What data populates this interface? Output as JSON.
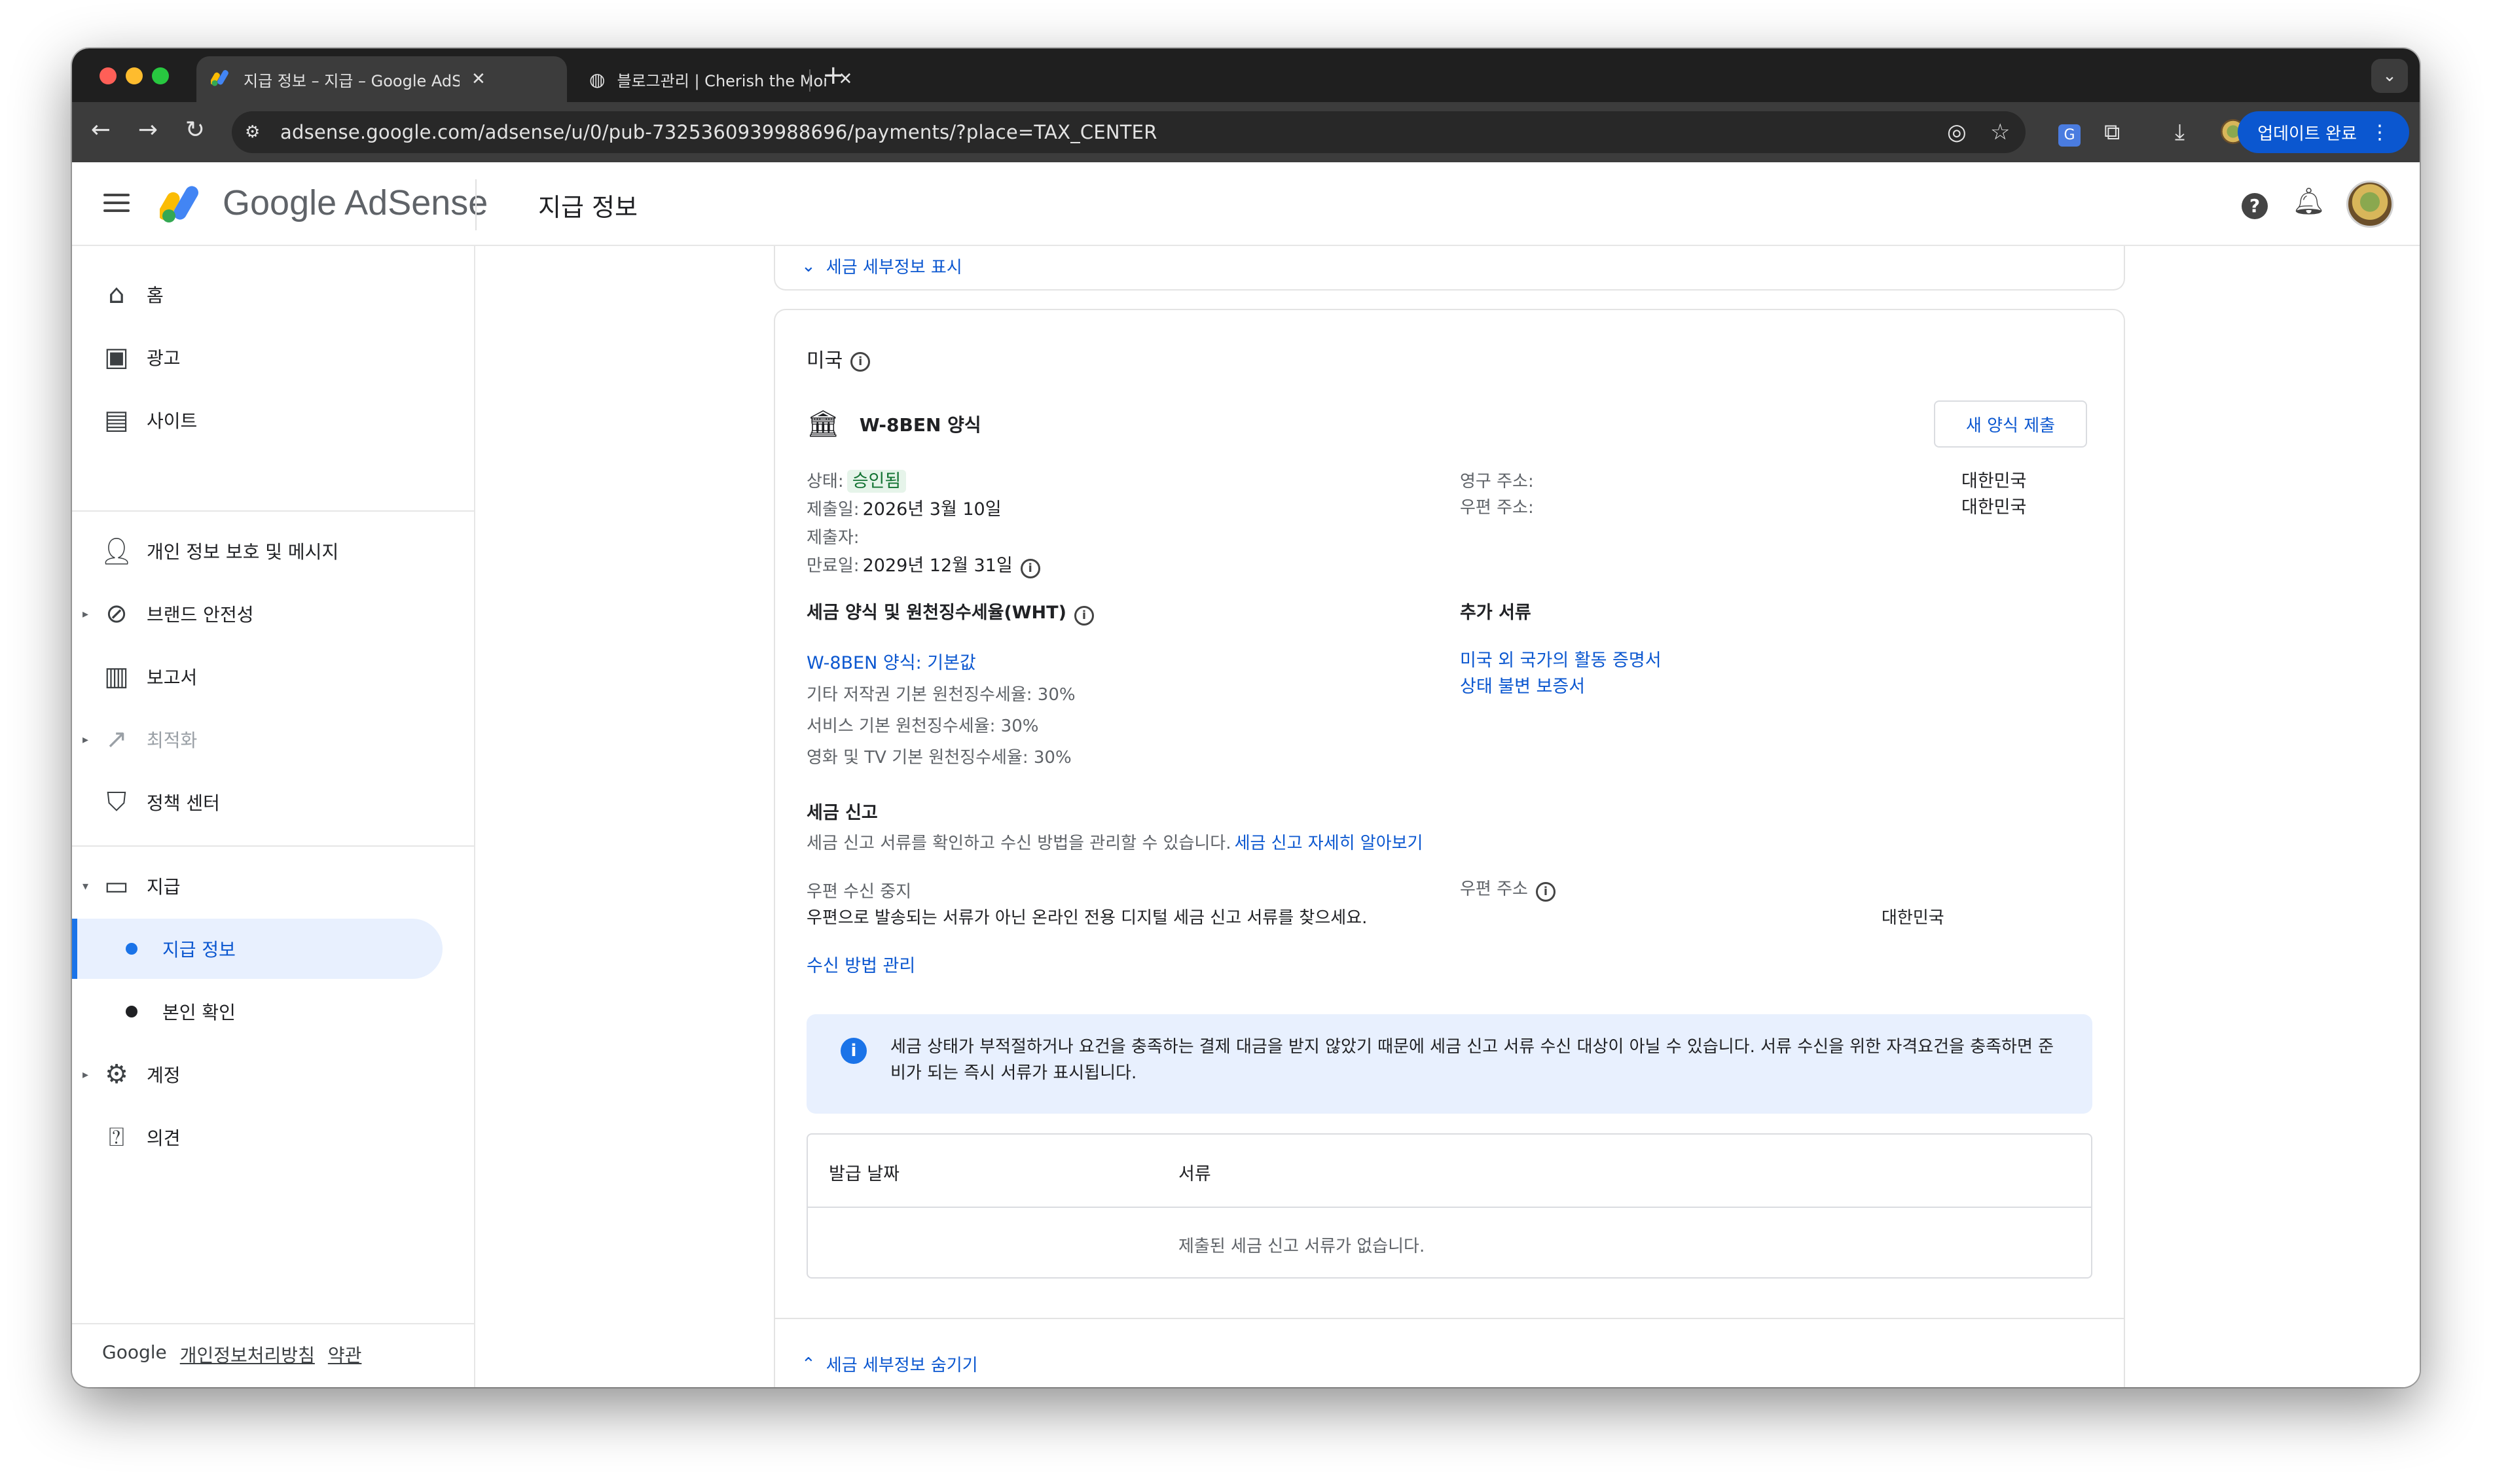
{
  "browser": {
    "tabs": [
      {
        "title": "지급 정보 – 지급 – Google AdSense",
        "active": true
      },
      {
        "title": "블로그관리 | Cherish the Moment",
        "active": false
      }
    ],
    "url": "adsense.google.com/adsense/u/0/pub-7325360939988696/payments/?place=TAX_CENTER",
    "update_label": "업데이트 완료"
  },
  "header": {
    "brand": "Google AdSense",
    "page_title": "지급 정보"
  },
  "sidebar": {
    "items": [
      {
        "label": "홈",
        "icon": "home-icon"
      },
      {
        "label": "광고",
        "icon": "ads-icon"
      },
      {
        "label": "사이트",
        "icon": "sites-icon"
      },
      {
        "label": "개인 정보 보호 및 메시지",
        "icon": "privacy-icon"
      },
      {
        "label": "브랜드 안전성",
        "icon": "block-icon"
      },
      {
        "label": "보고서",
        "icon": "reports-icon"
      },
      {
        "label": "최적화",
        "icon": "optimize-icon"
      },
      {
        "label": "정책 센터",
        "icon": "policy-icon"
      },
      {
        "label": "지급",
        "icon": "payments-icon"
      },
      {
        "label": "지급 정보",
        "icon": ""
      },
      {
        "label": "본인 확인",
        "icon": ""
      },
      {
        "label": "계정",
        "icon": "gear-icon"
      },
      {
        "label": "의견",
        "icon": "feedback-icon"
      }
    ],
    "footer": {
      "google": "Google",
      "privacy": "개인정보처리방침",
      "terms": "약관"
    }
  },
  "content": {
    "show_details": "세금 세부정보 표시",
    "hide_details": "세금 세부정보 숨기기",
    "country": "미국",
    "form_name": "W-8BEN 양식",
    "new_form_button": "새 양식 제출",
    "status_label": "상태:",
    "status_value": "승인됨",
    "submitted_label": "제출일:",
    "submitted_value": "2026년 3월 10일",
    "submitter_label": "제출자:",
    "expiry_label": "만료일:",
    "expiry_value": "2029년 12월 31일",
    "permanent_address_label": "영구 주소:",
    "permanent_address_value": "대한민국",
    "mailing_address_label": "우편 주소:",
    "mailing_address_value": "대한민국",
    "wht_heading": "세금 양식 및 원천징수세율(WHT)",
    "wht_link": "W-8BEN 양식: 기본값",
    "wht_rates": [
      "기타 저작권 기본 원천징수세율: 30%",
      "서비스 기본 원천징수세율: 30%",
      "영화 및 TV 기본 원천징수세율: 30%"
    ],
    "additional_docs_heading": "추가 서류",
    "additional_docs": [
      "미국 외 국가의 활동 증명서",
      "상태 불변 보증서"
    ],
    "tax_filing_heading": "세금 신고",
    "tax_filing_desc": "세금 신고 서류를 확인하고 수신 방법을 관리할 수 있습니다.",
    "tax_filing_learn_more": "세금 신고 자세히 알아보기",
    "mail_stop_label": "우편 수신 중지",
    "mail_stop_desc": "우편으로 발송되는 서류가 아닌 온라인 전용 디지털 세금 신고 서류를 찾으세요.",
    "mail_address_label": "우편 주소",
    "mail_address_value": "대한민국",
    "manage_receipt_link": "수신 방법 관리",
    "info_banner": "세금 상태가 부적절하거나 요건을 충족하는 결제 대금을 받지 않았기 때문에 세금 신고 서류 수신 대상이 아닐 수 있습니다. 서류 수신을 위한 자격요건을 충족하면 준비가 되는 즉시 서류가 표시됩니다.",
    "table_headers": [
      "발급 날짜",
      "서류"
    ],
    "table_empty": "제출된 세금 신고 서류가 없습니다."
  },
  "colors": {
    "accent": "#0b57d0",
    "selected_bg": "#e8f0fe",
    "status_green": "#137333",
    "chrome_dark": "#1f1f1f"
  }
}
